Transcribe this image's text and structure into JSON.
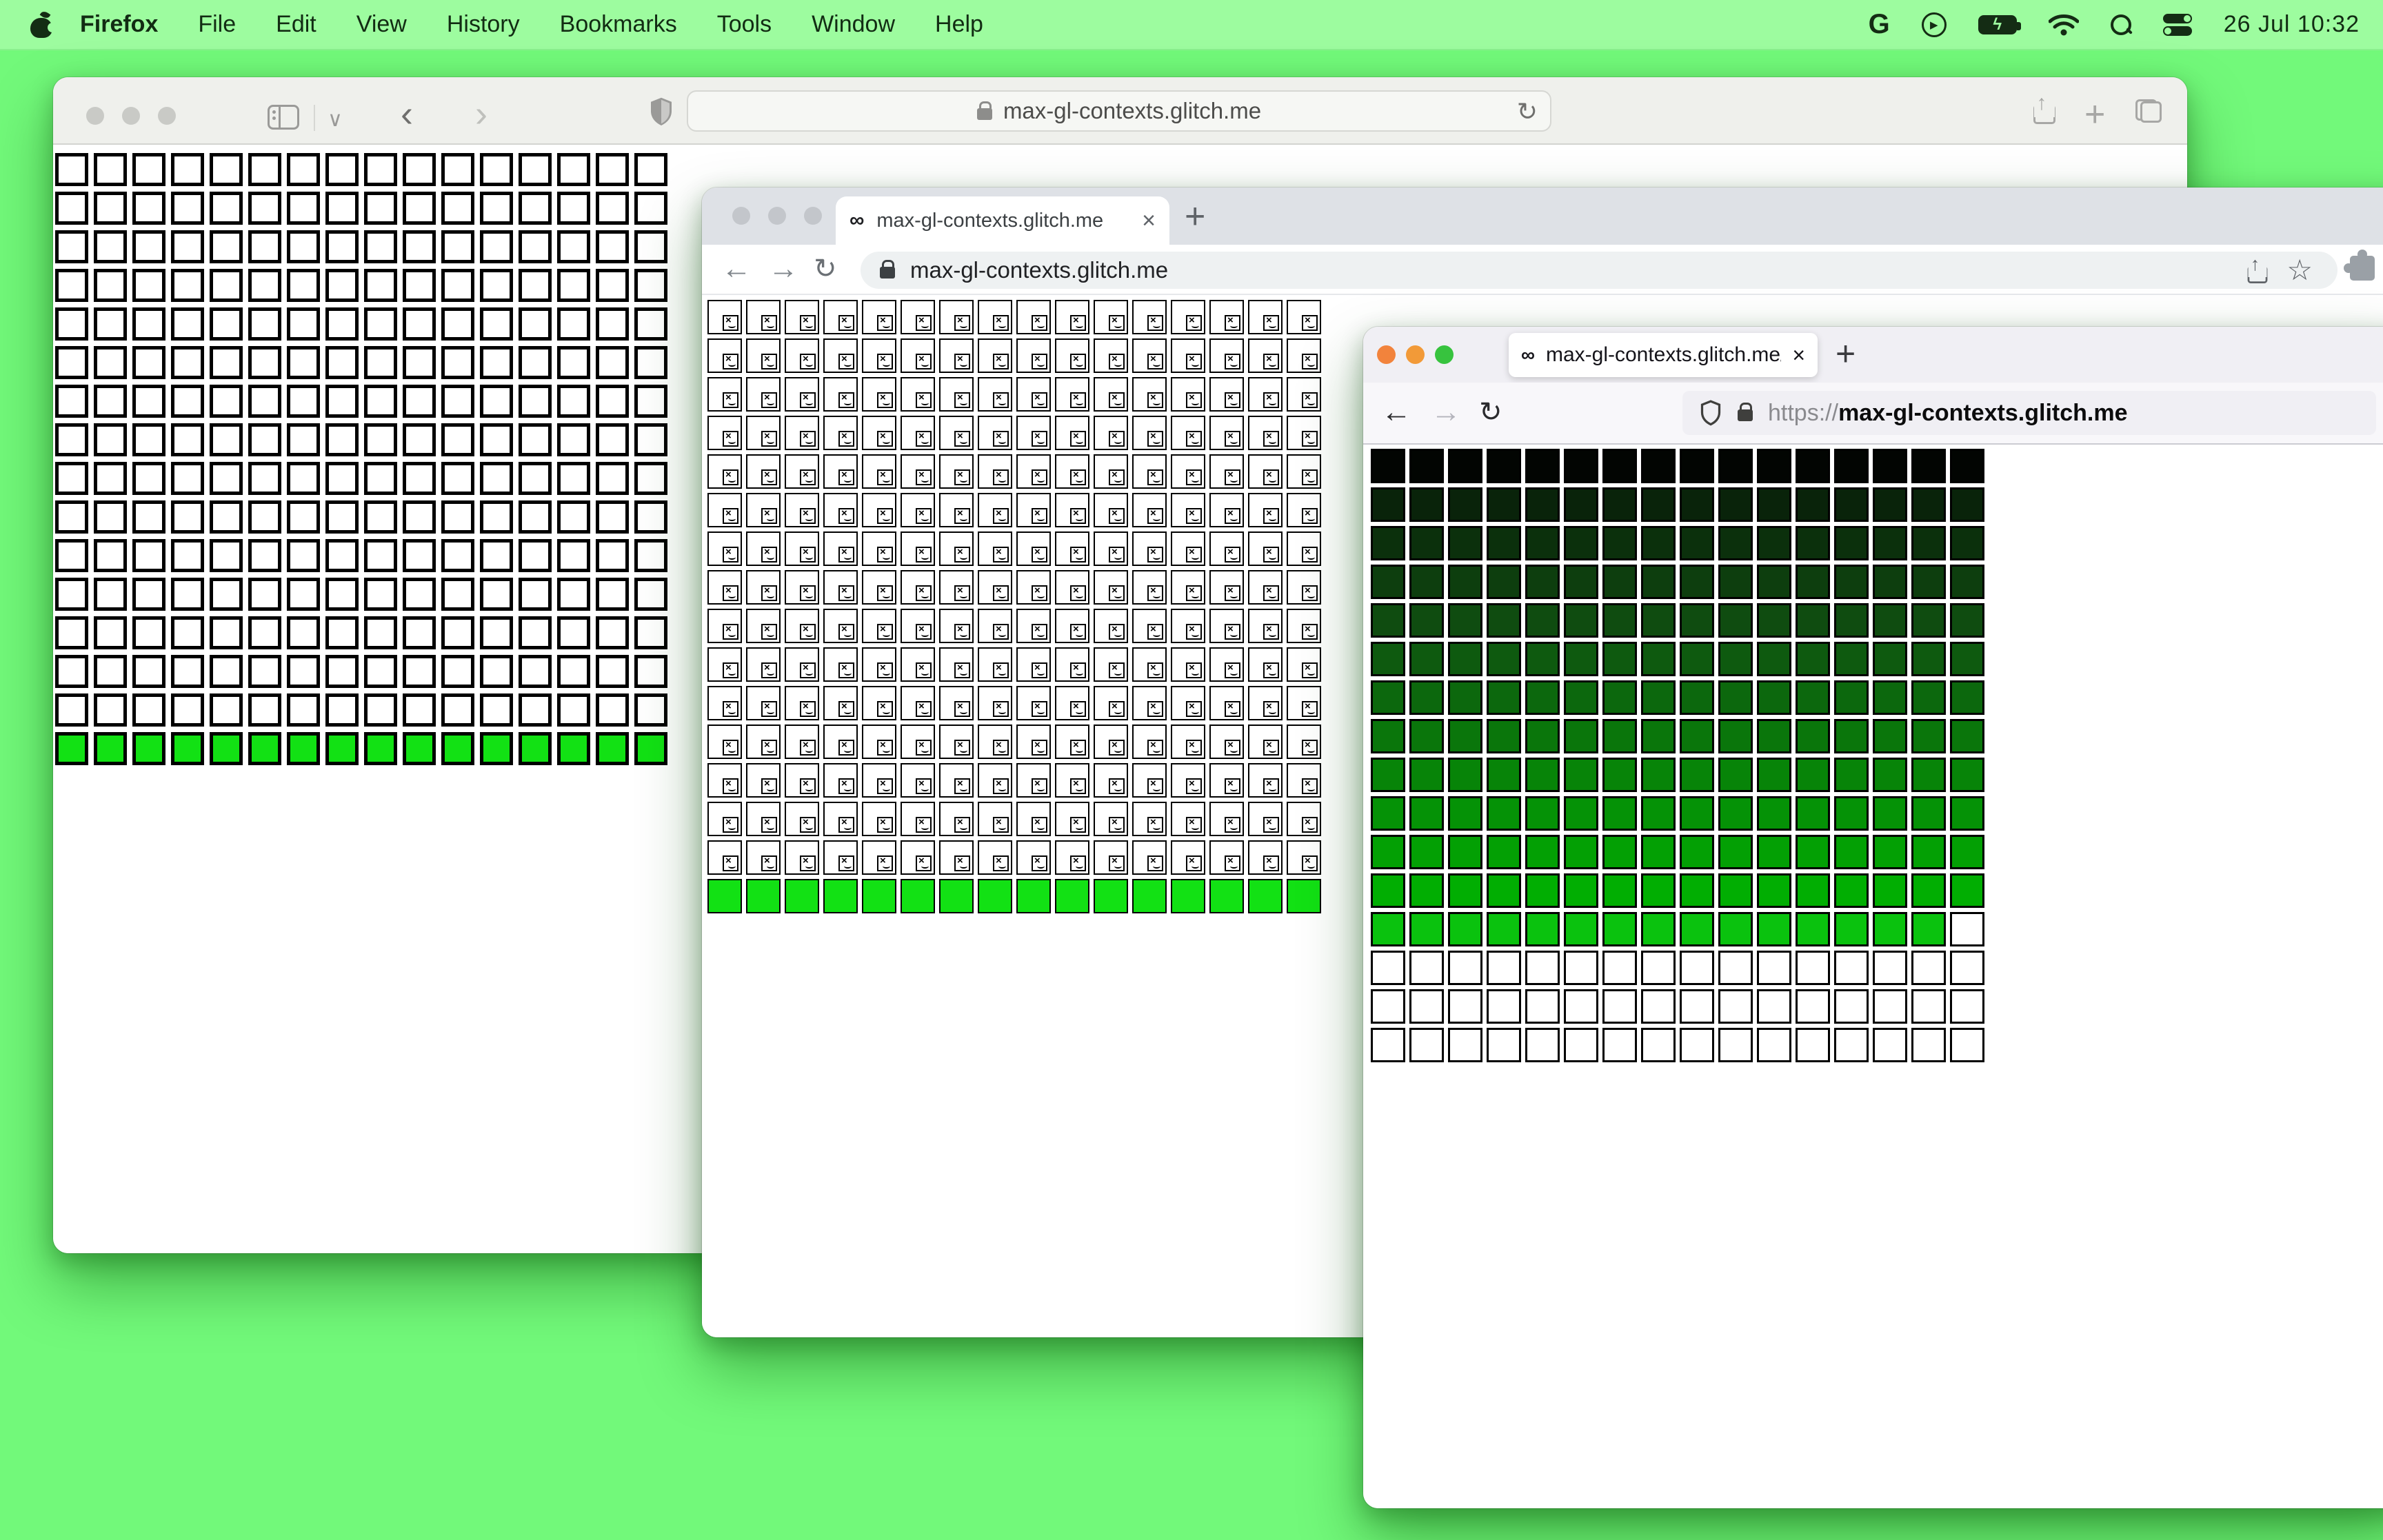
{
  "menu_bar": {
    "app_name": "Firefox",
    "items": [
      "File",
      "Edit",
      "View",
      "History",
      "Bookmarks",
      "Tools",
      "Window",
      "Help"
    ],
    "clock": "26 Jul 10:32",
    "status_icons": [
      "google-g",
      "play-circle",
      "battery-charging",
      "wifi",
      "spotlight-search",
      "control-center"
    ]
  },
  "glyphs": {
    "infinity": "∞",
    "close": "×",
    "plus": "+",
    "back": "←",
    "forward": "→",
    "reload": "↻",
    "safari_back": "‹",
    "safari_forward": "›",
    "chevron_down": "∨",
    "star": "☆",
    "bolt": "ϟ",
    "play": "▶",
    "google_g": "G",
    "broken_x": "×"
  },
  "colors": {
    "desktop": "#72f97a",
    "menu_bar_bg": "#9dfc9f",
    "bright_green_cell": "#12e114",
    "safari_toolbar": "#eff0ec",
    "chrome_tabstrip": "#dee1e6",
    "firefox_tabbar": "#f0eff4",
    "traffic_inactive": "#c9cac6",
    "firefox_dots": [
      "#f2833c",
      "#f29a38",
      "#37c33e"
    ]
  },
  "safari": {
    "url": "max-gl-contexts.glitch.me",
    "grid": {
      "cols": 16,
      "rows": 16,
      "green_row": 16
    }
  },
  "chrome": {
    "tab_title": "max-gl-contexts.glitch.me",
    "url": "max-gl-contexts.glitch.me",
    "grid": {
      "cols": 16,
      "rows": 16,
      "green_row": 16,
      "broken_rows": 15
    }
  },
  "firefox": {
    "tab_title": "max-gl-contexts.glitch.me/",
    "url_scheme": "https://",
    "url_host": "max-gl-contexts.glitch.me",
    "grid": {
      "cols": 16,
      "rows": 16,
      "row_colors": [
        "#020502",
        "#09230a",
        "#0b300c",
        "#0d3e0e",
        "#0f4c10",
        "#0e5a0f",
        "#0c680d",
        "#0a760b",
        "#078408",
        "#059206",
        "#03a004",
        "#01ae02",
        "#0ac20e"
      ],
      "white_cell": {
        "row": 13,
        "col": 16
      },
      "white_rows_from": 14
    }
  }
}
